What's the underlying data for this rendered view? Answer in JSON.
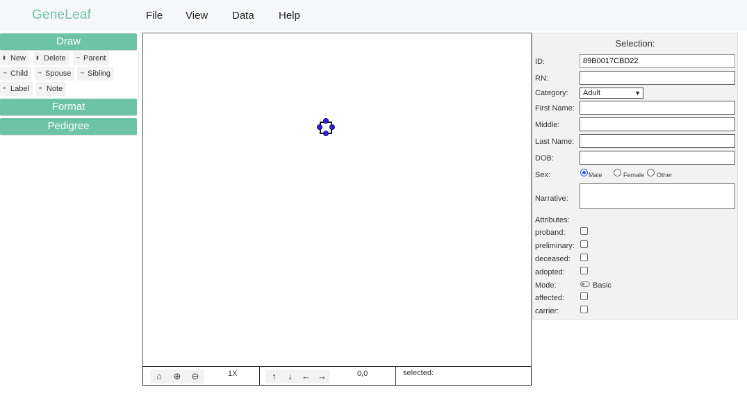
{
  "app": {
    "name": "GeneLeaf",
    "brand_color": "#6cc3a6"
  },
  "menu": [
    {
      "label": "File"
    },
    {
      "label": "View"
    },
    {
      "label": "Data"
    },
    {
      "label": "Help"
    }
  ],
  "left_panel": {
    "draw_label": "Draw",
    "format_label": "Format",
    "pedigree_label": "Pedigree",
    "tools": [
      {
        "label": "New",
        "icon": "file-icon"
      },
      {
        "label": "Delete",
        "icon": "trash-icon"
      },
      {
        "label": "Parent",
        "icon": "link-icon"
      },
      {
        "label": "Child",
        "icon": "link-icon"
      },
      {
        "label": "Spouse",
        "icon": "link-icon"
      },
      {
        "label": "Sibling",
        "icon": "link-icon"
      },
      {
        "label": "Label",
        "icon": "lines-icon"
      },
      {
        "label": "Note",
        "icon": "lines-icon"
      }
    ]
  },
  "toolbar": {
    "zoom_level": "1X",
    "coordinates": "0,0",
    "selected_label": "selected:"
  },
  "selection": {
    "title": "Selection:",
    "fields": {
      "id_label": "ID:",
      "id_value": "89B0017CBD22",
      "rn_label": "RN:",
      "rn_value": "",
      "category_label": "Category:",
      "category_value": "Adult",
      "first_label": "First Name:",
      "first_value": "",
      "middle_label": "Middle:",
      "middle_value": "",
      "last_label": "Last Name:",
      "last_value": "",
      "dob_label": "DOB:",
      "dob_value": ""
    },
    "sex_label": "Sex:",
    "sex_options": [
      "Male",
      "Female",
      "Other"
    ],
    "sex_selected": "Male",
    "narrative_label": "Narrative:",
    "attributes_label": "Attributes:",
    "attributes": [
      {
        "label": "proband:",
        "checked": false
      },
      {
        "label": "preliminary:",
        "checked": false
      },
      {
        "label": "deceased:",
        "checked": false
      },
      {
        "label": "adopted:",
        "checked": false
      }
    ],
    "mode_label": "Mode:",
    "mode_value": "Basic",
    "status": [
      {
        "label": "affected:",
        "checked": false
      },
      {
        "label": "carrier:",
        "checked": false
      }
    ]
  }
}
